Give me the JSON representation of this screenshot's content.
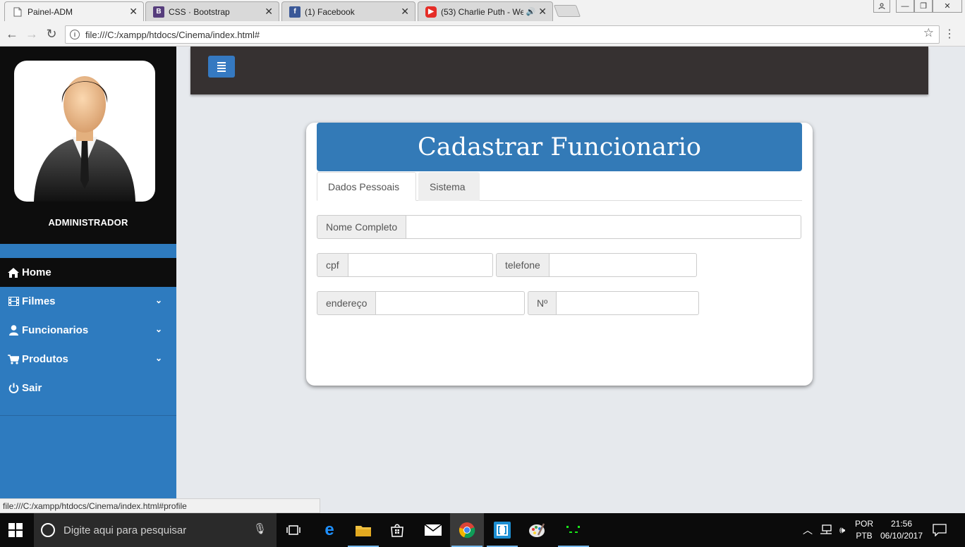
{
  "browser": {
    "tabs": [
      {
        "title": "Painel-ADM",
        "icon": "page-icon",
        "active": true
      },
      {
        "title": "CSS · Bootstrap",
        "icon": "bootstrap-icon",
        "active": false
      },
      {
        "title": "(1) Facebook",
        "icon": "facebook-icon",
        "active": false
      },
      {
        "title": "(53) Charlie Puth - We",
        "icon": "youtube-icon",
        "active": false,
        "audio": true
      }
    ],
    "url": "file:///C:/xampp/htdocs/Cinema/index.html#",
    "status_url": "file:///C:/xampp/htdocs/Cinema/index.html#profile"
  },
  "sidebar": {
    "role": "ADMINISTRADOR",
    "items": [
      {
        "label": "Home",
        "icon": "home-icon",
        "active": true,
        "has_submenu": false
      },
      {
        "label": "Filmes",
        "icon": "film-icon",
        "active": false,
        "has_submenu": true
      },
      {
        "label": "Funcionarios",
        "icon": "user-icon",
        "active": false,
        "has_submenu": true
      },
      {
        "label": "Produtos",
        "icon": "cart-icon",
        "active": false,
        "has_submenu": true
      },
      {
        "label": "Sair",
        "icon": "power-icon",
        "active": false,
        "has_submenu": false
      }
    ]
  },
  "form": {
    "title": "Cadastrar Funcionario",
    "tabs": [
      "Dados Pessoais",
      "Sistema"
    ],
    "fields": {
      "nome": {
        "label": "Nome Completo",
        "value": ""
      },
      "cpf": {
        "label": "cpf",
        "value": ""
      },
      "telefone": {
        "label": "telefone",
        "value": ""
      },
      "endereco": {
        "label": "endereço",
        "value": ""
      },
      "numero": {
        "label": "Nº",
        "value": ""
      }
    }
  },
  "taskbar": {
    "search_placeholder": "Digite aqui para pesquisar",
    "language": "POR",
    "layout": "PTB",
    "time": "21:56",
    "date": "06/10/2017"
  },
  "colors": {
    "primary": "#337ab7",
    "sidebar": "#2e7bbf",
    "sidebar_dark": "#0d0d0d",
    "topbar": "#363131",
    "page_bg": "#e6e9ed"
  }
}
